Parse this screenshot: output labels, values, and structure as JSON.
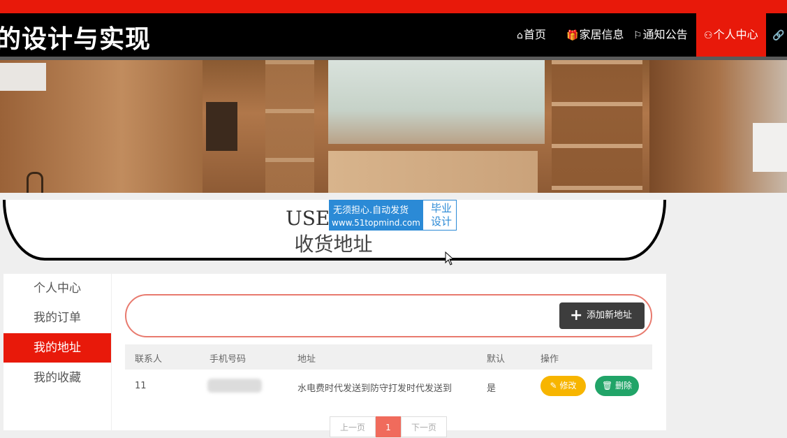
{
  "colors": {
    "brand": "#e8190a",
    "navbar": "#000000",
    "edit": "#f7b500",
    "delete": "#21a468",
    "page_active": "#f06b5c"
  },
  "header": {
    "site_title": "的设计与实现"
  },
  "nav": {
    "items": [
      {
        "icon": "home-icon",
        "label": "首页"
      },
      {
        "icon": "gift-icon",
        "label": "家居信息"
      },
      {
        "icon": "flag-icon",
        "label": "通知公告"
      },
      {
        "icon": "user-icon",
        "label": "个人中心"
      },
      {
        "icon": "link-icon",
        "label": ""
      }
    ]
  },
  "section": {
    "title_en": "USER / A",
    "title_cn": "收货地址"
  },
  "watermark": {
    "line1": "无须担心.自动发货",
    "line2": "www.51topmind.com",
    "right": "毕业设计"
  },
  "sidebar": {
    "items": [
      {
        "label": "个人中心"
      },
      {
        "label": "我的订单"
      },
      {
        "label": "我的地址"
      },
      {
        "label": "我的收藏"
      }
    ]
  },
  "toolbar": {
    "add_label": "添加新地址"
  },
  "table": {
    "headers": [
      "联系人",
      "手机号码",
      "地址",
      "默认",
      "操作"
    ],
    "rows": [
      {
        "contact": "11",
        "phone": "",
        "address": "水电费时代发送到防守打发时代发送到",
        "default": "是",
        "edit": "修改",
        "delete": "删除"
      }
    ]
  },
  "pagination": {
    "prev": "上一页",
    "current": "1",
    "next": "下一页"
  }
}
